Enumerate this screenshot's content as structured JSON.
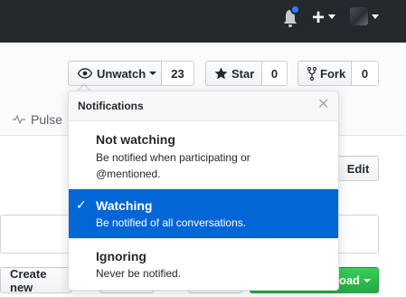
{
  "colors": {
    "header_bg": "#24292e",
    "accent": "#0366d6",
    "notification_dot": "#2188ff",
    "download_green": "#28a745"
  },
  "topbar": {
    "icons": [
      "bell-icon",
      "plus-icon",
      "avatar"
    ]
  },
  "repo_actions": {
    "unwatch_label": "Unwatch",
    "watch_count": "23",
    "star_label": "Star",
    "star_count": "0",
    "fork_label": "Fork",
    "fork_count": "0"
  },
  "nav": {
    "pulse_label": "Pulse"
  },
  "content": {
    "edit_label": "Edit",
    "create_label": "Create new",
    "download_label": "load"
  },
  "notifications_menu": {
    "title": "Notifications",
    "items": [
      {
        "title": "Not watching",
        "description": "Be notified when participating or @mentioned.",
        "selected": false
      },
      {
        "title": "Watching",
        "description": "Be notified of all conversations.",
        "selected": true
      },
      {
        "title": "Ignoring",
        "description": "Never be notified.",
        "selected": false
      }
    ]
  }
}
